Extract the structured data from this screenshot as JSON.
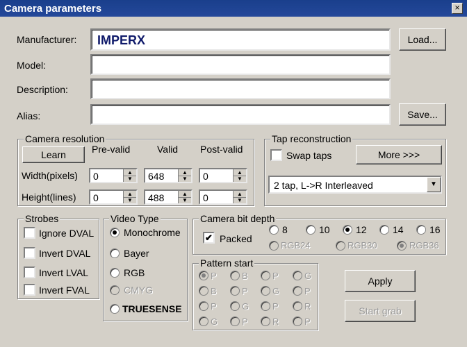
{
  "window": {
    "title": "Camera parameters",
    "close": "×"
  },
  "identity": {
    "manufacturer_label": "Manufacturer:",
    "manufacturer_value": "IMPERX",
    "model_label": "Model:",
    "model_value": "",
    "description_label": "Description:",
    "description_value": "",
    "alias_label": "Alias:",
    "alias_value": "",
    "load_button": "Load...",
    "save_button": "Save..."
  },
  "resolution": {
    "title": "Camera resolution",
    "learn_button": "Learn",
    "col_prevalid": "Pre-valid",
    "col_valid": "Valid",
    "col_postvalid": "Post-valid",
    "width_label": "Width(pixels)",
    "height_label": "Height(lines)",
    "width": {
      "pre": "0",
      "valid": "648",
      "post": "0"
    },
    "height": {
      "pre": "0",
      "valid": "488",
      "post": "0"
    }
  },
  "tap": {
    "title": "Tap reconstruction",
    "swap_label": "Swap taps",
    "swap_checked": false,
    "more_button": "More >>>",
    "mode_value": "2 tap, L->R Interleaved"
  },
  "strobes": {
    "title": "Strobes",
    "items": [
      {
        "label": "Ignore DVAL",
        "checked": false
      },
      {
        "label": "Invert DVAL",
        "checked": false
      },
      {
        "label": "Invert LVAL",
        "checked": false
      },
      {
        "label": "Invert FVAL",
        "checked": false
      }
    ]
  },
  "video": {
    "title": "Video Type",
    "options": [
      "Monochrome",
      "Bayer",
      "RGB",
      "CMYG",
      "TRUESENSE"
    ],
    "selected": "Monochrome"
  },
  "bitdepth": {
    "title": "Camera bit depth",
    "packed_label": "Packed",
    "packed_checked": true,
    "depths": [
      "8",
      "10",
      "12",
      "14",
      "16"
    ],
    "selected_depth": "12",
    "rgb": [
      "RGB24",
      "RGB30",
      "RGB36"
    ],
    "selected_rgb": "RGB36"
  },
  "pattern": {
    "title": "Pattern start",
    "rows": [
      [
        "P",
        "B",
        "P",
        "G"
      ],
      [
        "B",
        "P",
        "G",
        "P"
      ],
      [
        "P",
        "G",
        "P",
        "R"
      ],
      [
        "G",
        "P",
        "R",
        "P"
      ]
    ],
    "selected": [
      0,
      0
    ]
  },
  "actions": {
    "apply": "Apply",
    "start_grab": "Start grab"
  },
  "glyphs": {
    "check": "✔",
    "up": "▲",
    "down": "▼"
  }
}
